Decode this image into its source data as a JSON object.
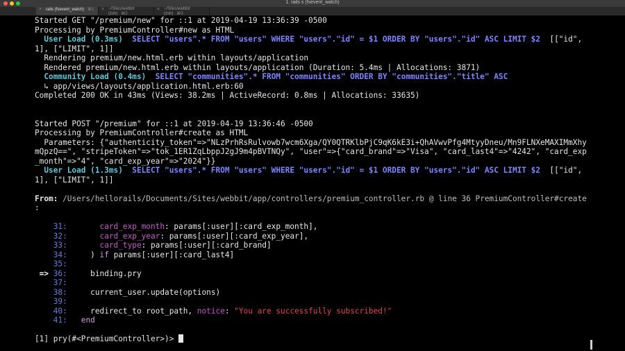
{
  "window": {
    "title": "1. rails s (fsevent_watch)",
    "tabs": [
      {
        "close": "×",
        "label": "rails (fsevent_watch)",
        "key": "⌘1"
      },
      {
        "close": "×",
        "label": "~/Sites/webbit (zsh)",
        "key": "⌘2"
      },
      {
        "close": "×",
        "label": "~/Sites/webbit (zsh)",
        "key": "⌘3"
      }
    ]
  },
  "terminal": {
    "req1_started": "Started GET \"/premium/new\" for ::1 at 2019-04-19 13:36:39 -0500",
    "req1_processing": "Processing by PremiumController#new as HTML",
    "req1_user_load_label": "  User Load (0.3ms)",
    "req1_user_load_sql": "  SELECT \"users\".* FROM \"users\" WHERE \"users\".\"id\" = $1 ORDER BY \"users\".\"id\" ASC LIMIT $2",
    "req1_user_load_binds": "  [[\"id\",",
    "req1_user_load_cont": "1], [\"LIMIT\", 1]]",
    "req1_rendering": "  Rendering premium/new.html.erb within layouts/application",
    "req1_rendered": "  Rendered premium/new.html.erb within layouts/application (Duration: 5.4ms | Allocations: 3871)",
    "req1_community_label": "  Community Load (0.4ms)",
    "req1_community_sql": "  SELECT \"communities\".* FROM \"communities\" ORDER BY \"communities\".\"title\" ASC",
    "req1_community_trace": "  ↳ app/views/layouts/application.html.erb:60",
    "req1_completed": "Completed 200 OK in 43ms (Views: 38.2ms | ActiveRecord: 0.8ms | Allocations: 33635)",
    "req2_started": "Started POST \"/premium\" for ::1 at 2019-04-19 13:36:46 -0500",
    "req2_processing": "Processing by PremiumController#create as HTML",
    "req2_params_1": "  Parameters: {\"authenticity_token\"=>\"NLzPrhRsRulvowb7wcm6Xga/QY0QTRKlbPjC9qK6kE3i+QhAVwvPfg4MtyyDneu/Mn9FLNXeMAXIMmXhy",
    "req2_params_2": "mQpzQ==\", \"stripeToken\"=>\"tok_1ER1ZqLbppJ2gJ9m4pBVTNQy\", \"user\"=>{\"card_brand\"=>\"Visa\", \"card_last4\"=>\"4242\", \"card_exp",
    "req2_params_3": "_month\"=>\"4\", \"card_exp_year\"=>\"2024\"}}",
    "req2_user_load_label": "  User Load (1.3ms)",
    "req2_user_load_sql": "  SELECT \"users\".* FROM \"users\" WHERE \"users\".\"id\" = $1 ORDER BY \"users\".\"id\" ASC LIMIT $2",
    "req2_user_load_binds": "  [[\"id\",",
    "req2_user_load_cont": "1], [\"LIMIT\", 1]]",
    "from_label": "From:",
    "from_path": " /Users/hellorails/Documents/Sites/webbit/app/controllers/premium_controller.rb @ line 36 PremiumController#create",
    "from_cont": ":",
    "code": {
      "l31_num": "    31:",
      "l31_sym": "       card_exp_month",
      "l31_rest": ": params[:user][:card_exp_month],",
      "l32_num": "    32:",
      "l32_sym": "       card_exp_year",
      "l32_rest": ": params[:user][:card_exp_year],",
      "l33_num": "    33:",
      "l33_sym": "       card_type",
      "l33_rest": ": params[:user][:card_brand]",
      "l34_num": "    34:",
      "l34_pre": "     ) ",
      "l34_kw": "if",
      "l34_rest": " params[:user][:card_last4]",
      "l35_num": "    35:",
      "l36_arrow": " => ",
      "l36_num": "36:",
      "l36_rest": "     binding.pry",
      "l37_num": "    37:",
      "l38_num": "    38:",
      "l38_rest": "     current_user.update(options)",
      "l39_num": "    39:",
      "l40_num": "    40:",
      "l40_pre": "     redirect_to root_path, ",
      "l40_sym": "notice",
      "l40_colon": ": ",
      "l40_str": "\"You are successfully subscribed!\"",
      "l41_num": "    41:",
      "l41_kw": "   end"
    },
    "prompt": "[1] pry(#<PremiumController>)> "
  }
}
